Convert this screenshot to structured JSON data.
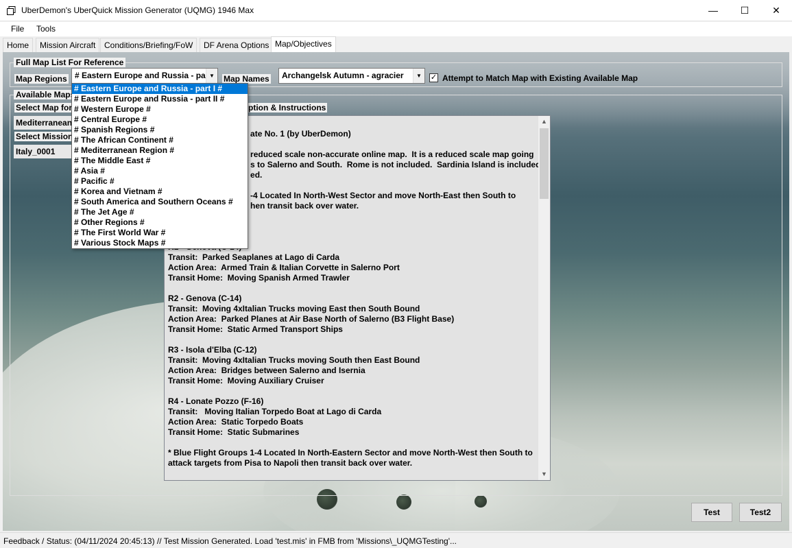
{
  "window": {
    "title": "UberDemon's UberQuick Mission Generator (UQMG) 1946 Max",
    "minimize_glyph": "—",
    "maximize_glyph": "☐",
    "close_glyph": "✕"
  },
  "menu": {
    "file": "File",
    "tools": "Tools"
  },
  "tabs": [
    "Home",
    "Mission Aircraft",
    "Conditions/Briefing/FoW",
    "DF Arena Options",
    "Map/Objectives"
  ],
  "full_map_list": {
    "title": "Full Map List For Reference",
    "map_regions_label": "Map Regions",
    "map_regions_value": "# Eastern Europe and Russia - part",
    "map_names_label": "Map Names",
    "map_names_value": "Archangelsk Autumn - agracier",
    "attempt_match_label": "Attempt to Match Map with Existing Available Map",
    "attempt_match_checked": true
  },
  "available_maps": {
    "title": "Available Maps",
    "select_map_label": "Select Map for",
    "map_field_value": "Mediterranean",
    "select_mission_label": "Select Mission",
    "mission_field_value": "Italy_0001",
    "desc_title": "ption & Instructions"
  },
  "description_lines": [
    "",
    "                                    ate No. 1 (by UberDemon)",
    "",
    "                                    reduced scale non-accurate online map.  It is a reduced scale map going",
    "                                    s to Salerno and South.  Rome is not included.  Sardinia Island is included",
    "                                    ed.",
    "",
    "                                    -4 Located In North-West Sector and move North-East then South to",
    "                                    hen transit back over water.",
    "",
    "",
    "",
    "R1 - Genova (C-14)",
    "Transit:  Parked Seaplanes at Lago di Carda",
    "Action Area:  Armed Train & Italian Corvette in Salerno Port",
    "Transit Home:  Moving Spanish Armed Trawler",
    "",
    "R2 - Genova (C-14)",
    "Transit:  Moving 4xItalian Trucks moving East then South Bound",
    "Action Area:  Parked Planes at Air Base North of Salerno (B3 Flight Base)",
    "Transit Home:  Static Armed Transport Ships",
    "",
    "R3 - Isola d'Elba (C-12)",
    "Transit:  Moving 4xItalian Trucks moving South then East Bound",
    "Action Area:  Bridges between Salerno and Isernia",
    "Transit Home:  Moving Auxiliary Cruiser",
    "",
    "R4 - Lonate Pozzo (F-16)",
    "Transit:   Moving Italian Torpedo Boat at Lago di Carda",
    "Action Area:  Static Torpedo Boats",
    "Transit Home:  Static Submarines",
    "",
    "* Blue Flight Groups 1-4 Located In North-Eastern Sector and move North-West then South to",
    "attack targets from Pisa to Napoli then transit back over water."
  ],
  "region_dropdown": [
    "# Eastern Europe and Russia - part I #",
    "# Eastern Europe and Russia - part II #",
    "# Western Europe #",
    "# Central Europe #",
    "# Spanish Regions #",
    "# The African Continent #",
    "# Mediterranean Region #",
    "# The Middle East #",
    "# Asia #",
    "# Pacific #",
    "# Korea and Vietnam #",
    "# South America and Southern Oceans #",
    "# The Jet Age #",
    "# Other Regions #",
    "# The First World War #",
    "# Various Stock Maps #"
  ],
  "region_dropdown_selected": 0,
  "buttons": {
    "test": "Test",
    "test2": "Test2"
  },
  "status": {
    "text": "Feedback / Status:   (04/11/2024 20:45:13) // Test Mission Generated.  Load 'test.mis' in FMB from 'Missions\\_UQMGTesting'..."
  }
}
